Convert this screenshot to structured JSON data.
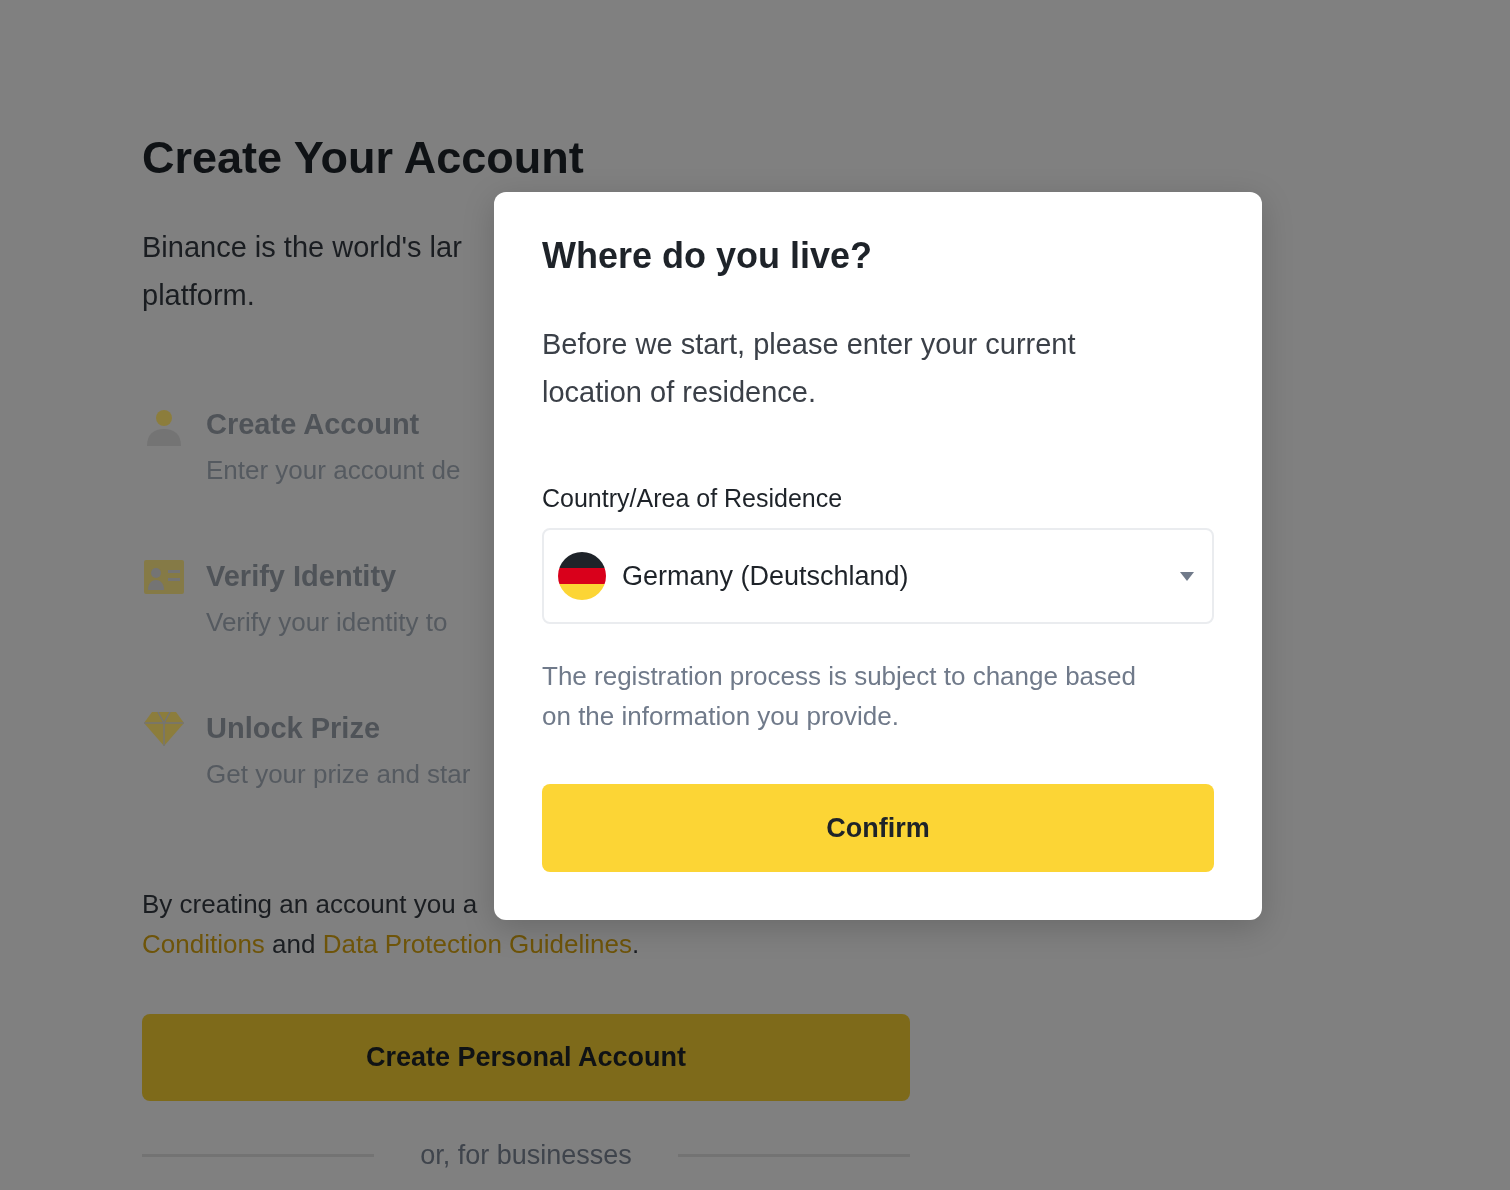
{
  "background_page": {
    "title": "Create Your Account",
    "intro": [
      "Binance is the world's lar",
      "platform."
    ],
    "steps": [
      {
        "title": "Create Account",
        "description": "Enter your account de"
      },
      {
        "title": "Verify Identity",
        "description": "Verify your identity to"
      },
      {
        "title": "Unlock Prize",
        "description": "Get your prize and star"
      }
    ],
    "terms_first_line": "By creating an account you a",
    "terms_second_line": [
      {
        "text": "Conditions",
        "link": true
      },
      {
        "text": " and ",
        "link": false
      },
      {
        "text": "Data Protection Guidelines",
        "link": true
      },
      {
        "text": ".",
        "link": false
      }
    ],
    "primary_button": "Create Personal Account",
    "separator_text": "or, for businesses"
  },
  "dialog": {
    "title": "Where do you live?",
    "description": "Before we start, please enter your current location of residence.",
    "field_label": "Country/Area of Residence",
    "country_select": {
      "value": "Germany (Deutschland)"
    },
    "note": "The registration process is subject to change based on the information you provide.",
    "confirm_button": "Confirm"
  }
}
